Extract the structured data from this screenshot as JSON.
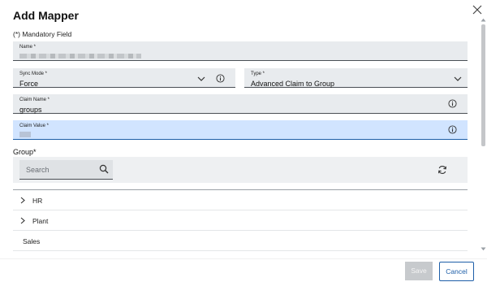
{
  "dialog": {
    "title": "Add Mapper",
    "mandatory_note": "(*) Mandatory Field"
  },
  "fields": {
    "name": {
      "label": "Name *",
      "value": ""
    },
    "sync_mode": {
      "label": "Sync Mode *",
      "value": "Force"
    },
    "type": {
      "label": "Type *",
      "value": "Advanced Claim to Group"
    },
    "claim_name": {
      "label": "Claim Name *",
      "value": "groups"
    },
    "claim_value": {
      "label": "Claim Value *",
      "value": ""
    }
  },
  "group": {
    "label": "Group*",
    "search_placeholder": "Search",
    "items": [
      {
        "label": "HR",
        "expandable": true
      },
      {
        "label": "Plant",
        "expandable": true
      },
      {
        "label": "Sales",
        "expandable": false
      }
    ]
  },
  "footer": {
    "save_label": "Save",
    "cancel_label": "Cancel"
  },
  "colors": {
    "accent": "#1d5ea8",
    "field_bg": "#e8ebee",
    "focus_bg": "#d1e4ff",
    "disabled_btn": "#c7cacd"
  },
  "icons": {
    "close": "close-icon",
    "dropdown": "chevron-down-icon",
    "info": "info-icon",
    "search": "search-icon",
    "refresh": "refresh-icon",
    "expand": "chevron-right-icon"
  }
}
